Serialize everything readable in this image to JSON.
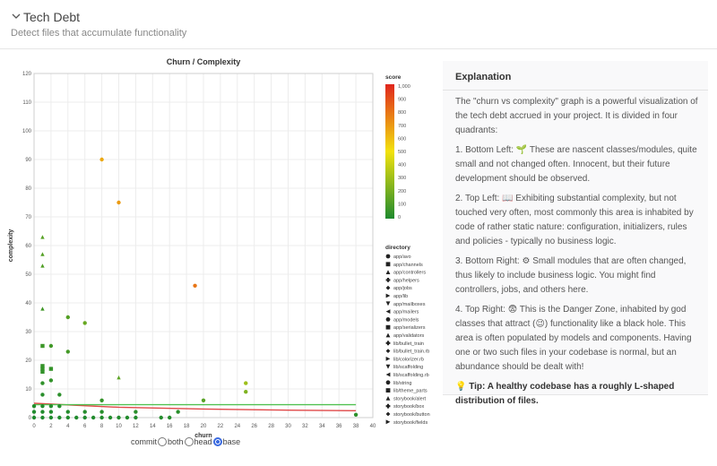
{
  "header": {
    "title": "Tech Debt",
    "subtitle": "Detect files that accumulate functionality"
  },
  "chart_data": {
    "type": "scatter",
    "title": "Churn / Complexity",
    "xlabel": "churn",
    "ylabel": "complexity",
    "xlim": [
      0,
      40
    ],
    "ylim": [
      0,
      120
    ],
    "x_ticks": [
      0,
      2,
      4,
      6,
      8,
      10,
      12,
      14,
      16,
      18,
      20,
      22,
      24,
      26,
      28,
      30,
      32,
      34,
      36,
      38,
      40
    ],
    "y_ticks": [
      0,
      10,
      20,
      30,
      40,
      50,
      60,
      70,
      80,
      90,
      100,
      110,
      120
    ],
    "grid": true,
    "color_legend": {
      "title": "score",
      "ticks": [
        "1,000",
        "900",
        "800",
        "700",
        "600",
        "500",
        "400",
        "300",
        "200",
        "100",
        "0"
      ],
      "range": [
        0,
        1100
      ],
      "colors": [
        "#1e8a2e",
        "#f2e20c",
        "#e0261d"
      ]
    },
    "shape_legend": {
      "title": "directory",
      "items": [
        {
          "label": "app/avo",
          "shape": "circle"
        },
        {
          "label": "app/channels",
          "shape": "square"
        },
        {
          "label": "app/controllers",
          "shape": "triangle-up"
        },
        {
          "label": "app/helpers",
          "shape": "cross"
        },
        {
          "label": "app/jobs",
          "shape": "diamond"
        },
        {
          "label": "app/lib",
          "shape": "triangle-right"
        },
        {
          "label": "app/mailboxes",
          "shape": "triangle-down"
        },
        {
          "label": "app/mailers",
          "shape": "triangle-left"
        },
        {
          "label": "app/models",
          "shape": "circle"
        },
        {
          "label": "app/serializers",
          "shape": "square"
        },
        {
          "label": "app/validators",
          "shape": "triangle-up"
        },
        {
          "label": "lib/bullet_train",
          "shape": "cross"
        },
        {
          "label": "lib/bullet_train.rb",
          "shape": "diamond"
        },
        {
          "label": "lib/colorizer.rb",
          "shape": "triangle-right"
        },
        {
          "label": "lib/scaffolding",
          "shape": "triangle-down"
        },
        {
          "label": "lib/scaffolding.rb",
          "shape": "triangle-left"
        },
        {
          "label": "lib/string",
          "shape": "circle"
        },
        {
          "label": "lib/theme_parts",
          "shape": "square"
        },
        {
          "label": "storybook/alert",
          "shape": "triangle-up"
        },
        {
          "label": "storybook/box",
          "shape": "cross"
        },
        {
          "label": "storybook/button",
          "shape": "diamond"
        },
        {
          "label": "storybook/fields",
          "shape": "triangle-right"
        }
      ]
    },
    "points": [
      {
        "x": 8,
        "y": 90,
        "shape": "circle",
        "score": 720
      },
      {
        "x": 10,
        "y": 75,
        "shape": "circle",
        "score": 760
      },
      {
        "x": 19,
        "y": 46,
        "shape": "circle",
        "score": 870
      },
      {
        "x": 1,
        "y": 63,
        "shape": "triangle-up",
        "score": 150
      },
      {
        "x": 1,
        "y": 57,
        "shape": "triangle-up",
        "score": 140
      },
      {
        "x": 1,
        "y": 53,
        "shape": "triangle-up",
        "score": 130
      },
      {
        "x": 1,
        "y": 38,
        "shape": "triangle-up",
        "score": 90
      },
      {
        "x": 4,
        "y": 35,
        "shape": "circle",
        "score": 140
      },
      {
        "x": 6,
        "y": 33,
        "shape": "circle",
        "score": 190
      },
      {
        "x": 1,
        "y": 25,
        "shape": "square",
        "score": 80
      },
      {
        "x": 2,
        "y": 25,
        "shape": "circle",
        "score": 90
      },
      {
        "x": 4,
        "y": 23,
        "shape": "circle",
        "score": 100
      },
      {
        "x": 1,
        "y": 18,
        "shape": "square",
        "score": 60
      },
      {
        "x": 1,
        "y": 17,
        "shape": "square",
        "score": 60
      },
      {
        "x": 1,
        "y": 16,
        "shape": "square",
        "score": 55
      },
      {
        "x": 2,
        "y": 17,
        "shape": "square",
        "score": 60
      },
      {
        "x": 2,
        "y": 13,
        "shape": "circle",
        "score": 55
      },
      {
        "x": 1,
        "y": 12,
        "shape": "circle",
        "score": 50
      },
      {
        "x": 10,
        "y": 14,
        "shape": "triangle-up",
        "score": 160
      },
      {
        "x": 25,
        "y": 12,
        "shape": "circle",
        "score": 330
      },
      {
        "x": 25,
        "y": 9,
        "shape": "circle",
        "score": 250
      },
      {
        "x": 3,
        "y": 8,
        "shape": "circle",
        "score": 40
      },
      {
        "x": 1,
        "y": 8,
        "shape": "circle",
        "score": 30
      },
      {
        "x": 8,
        "y": 6,
        "shape": "circle",
        "score": 60
      },
      {
        "x": 20,
        "y": 6,
        "shape": "circle",
        "score": 150
      },
      {
        "x": 0,
        "y": 4,
        "shape": "circle",
        "score": 10
      },
      {
        "x": 1,
        "y": 4,
        "shape": "circle",
        "score": 15
      },
      {
        "x": 2,
        "y": 4,
        "shape": "circle",
        "score": 20
      },
      {
        "x": 3,
        "y": 4,
        "shape": "circle",
        "score": 20
      },
      {
        "x": 0,
        "y": 2,
        "shape": "circle",
        "score": 8
      },
      {
        "x": 1,
        "y": 2,
        "shape": "circle",
        "score": 10
      },
      {
        "x": 2,
        "y": 2,
        "shape": "circle",
        "score": 12
      },
      {
        "x": 4,
        "y": 2,
        "shape": "circle",
        "score": 15
      },
      {
        "x": 0,
        "y": 0,
        "shape": "circle",
        "score": 5
      },
      {
        "x": 1,
        "y": 0,
        "shape": "circle",
        "score": 5
      },
      {
        "x": 2,
        "y": 0,
        "shape": "circle",
        "score": 6
      },
      {
        "x": 3,
        "y": 0,
        "shape": "circle",
        "score": 6
      },
      {
        "x": 4,
        "y": 0,
        "shape": "circle",
        "score": 7
      },
      {
        "x": 5,
        "y": 0,
        "shape": "circle",
        "score": 8
      },
      {
        "x": 6,
        "y": 0,
        "shape": "circle",
        "score": 8
      },
      {
        "x": 7,
        "y": 0,
        "shape": "circle",
        "score": 9
      },
      {
        "x": 8,
        "y": 0,
        "shape": "circle",
        "score": 10
      },
      {
        "x": 9,
        "y": 0,
        "shape": "circle",
        "score": 10
      },
      {
        "x": 10,
        "y": 0,
        "shape": "circle",
        "score": 10
      },
      {
        "x": 11,
        "y": 0,
        "shape": "circle",
        "score": 12
      },
      {
        "x": 12,
        "y": 0,
        "shape": "circle",
        "score": 12
      },
      {
        "x": 15,
        "y": 0,
        "shape": "circle",
        "score": 15
      },
      {
        "x": 16,
        "y": 0,
        "shape": "circle",
        "score": 15
      },
      {
        "x": 17,
        "y": 2,
        "shape": "circle",
        "score": 30
      },
      {
        "x": 6,
        "y": 2,
        "shape": "circle",
        "score": 20
      },
      {
        "x": 8,
        "y": 2,
        "shape": "circle",
        "score": 25
      },
      {
        "x": 12,
        "y": 2,
        "shape": "circle",
        "score": 30
      },
      {
        "x": 38,
        "y": 1,
        "shape": "circle",
        "score": 40
      }
    ],
    "lines": [
      {
        "name": "trend",
        "color": "#e04848",
        "points": [
          [
            0,
            5.0
          ],
          [
            10,
            3.6
          ],
          [
            20,
            3.0
          ],
          [
            30,
            2.6
          ],
          [
            38,
            2.4
          ]
        ]
      },
      {
        "name": "threshold",
        "color": "#52c152",
        "points": [
          [
            0,
            4.5
          ],
          [
            38,
            4.5
          ]
        ]
      }
    ]
  },
  "radio": {
    "options": [
      "commit",
      "both",
      "head",
      "base"
    ],
    "selected": "base"
  },
  "explanation": {
    "title": "Explanation",
    "intro": "The \"churn vs complexity\" graph is a powerful visualization of the tech debt accrued in your project. It is divided in four quadrants:",
    "q1": "1. Bottom Left: 🌱 These are nascent classes/modules, quite small and not changed often. Innocent, but their future development should be observed.",
    "q2": "2. Top Left: 📖 Exhibiting substantial complexity, but not touched very often, most commonly this area is inhabited by code of rather static nature: configuration, initializers, rules and policies - typically no business logic.",
    "q3": "3. Bottom Right: ⚙ Small modules that are often changed, thus likely to include business logic. You might find controllers, jobs, and others here.",
    "q4": "4. Top Right: 😨 This is the Danger Zone, inhabited by god classes that attract (😉) functionality like a black hole. This area is often populated by models and components. Having one or two such files in your codebase is normal, but an abundance should be dealt with!",
    "tip": "💡 Tip: A healthy codebase has a roughly L-shaped distribution of files."
  }
}
